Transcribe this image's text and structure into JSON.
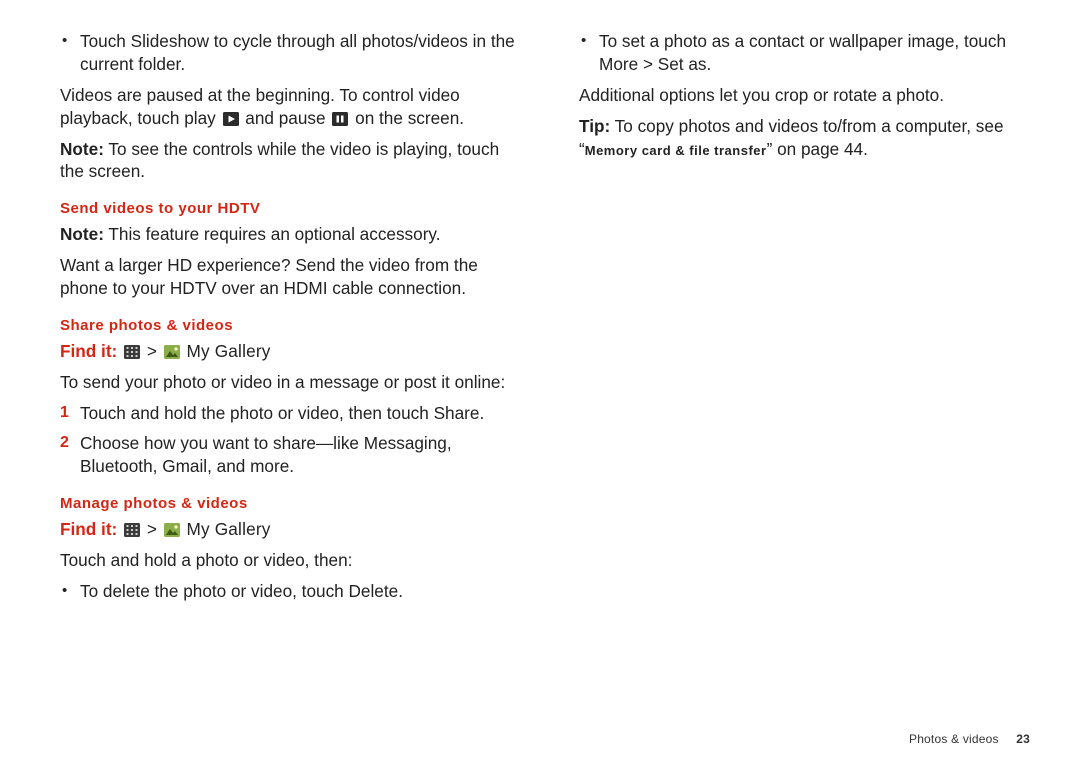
{
  "col1": {
    "bullet1_pre": "Touch ",
    "bullet1_action": "Slideshow",
    "bullet1_post": " to cycle through all photos/videos in the current folder.",
    "videos_line_a": "Videos are paused at the beginning. To control video playback, touch play ",
    "videos_line_b": " and pause ",
    "videos_line_c": " on the screen.",
    "note1_label": "Note:",
    "note1_text": " To see the controls while the video is playing, touch the screen.",
    "h_send": "Send videos to your HDTV",
    "note2_label": "Note:",
    "note2_text": " This feature requires an optional accessory.",
    "send_p": "Want a larger HD experience? Send the video from the phone to your HDTV over an HDMI cable connection.",
    "h_share": "Share photos & videos",
    "findit_label": "Find it:",
    "gallery_text": "My Gallery",
    "share_intro": "To send your photo or video in a message or post it online:",
    "step1_pre": "Touch and hold the photo or video, then touch ",
    "step1_action": "Share",
    "step1_post": ".",
    "step2_pre": "Choose how you want to share—like ",
    "step2_a": "Messaging",
    "step2_b": "Bluetooth",
    "step2_c": "Gmail",
    "step2_post": ", and more.",
    "h_manage": "Manage photos & videos",
    "manage_intro": "Touch and hold a photo or video, then:",
    "manage_b1_pre": "To delete the photo or video, touch ",
    "manage_b1_action": "Delete",
    "manage_b1_post": "."
  },
  "col2": {
    "set_b_pre": "To set a photo as a contact or wallpaper image, touch ",
    "set_b_a": "More",
    "set_b_gt": " > ",
    "set_b_b": "Set as",
    "set_b_post": ".",
    "addl": "Additional options let you crop or rotate a photo.",
    "tip_label": "Tip:",
    "tip_a": " To copy photos and videos to/from a computer, see “",
    "tip_sc": "Memory card & file transfer",
    "tip_b": "” on page 44."
  },
  "footer": {
    "section": "Photos & videos",
    "page": "23"
  },
  "icons": {
    "play": "play-icon",
    "pause": "pause-icon",
    "apps": "apps-grid-icon",
    "gallery": "gallery-icon"
  }
}
